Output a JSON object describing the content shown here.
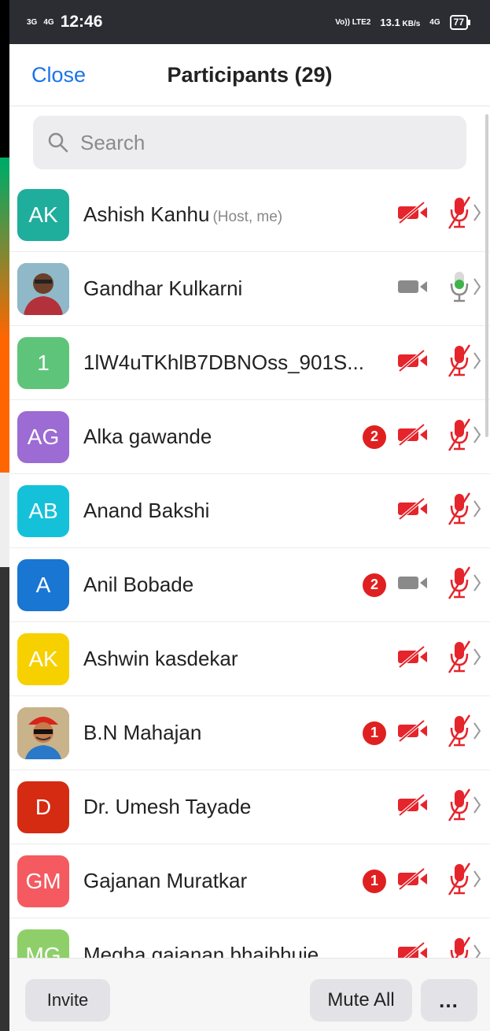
{
  "status_bar": {
    "signal1": "3G",
    "signal2": "4G",
    "time": "12:46",
    "volte": "Vo)) LTE2",
    "speed": "13.1",
    "speed_unit": "KB/s",
    "network": "4G",
    "battery": "77"
  },
  "header": {
    "close_label": "Close",
    "title": "Participants (29)"
  },
  "search": {
    "placeholder": "Search"
  },
  "participants": [
    {
      "initials": "AK",
      "name": "Ashish Kanhu",
      "sub": "(Host, me)",
      "avatar_color": "#1fae9b",
      "badge": "",
      "video": "off",
      "audio": "muted"
    },
    {
      "initials": "",
      "name": "Gandhar Kulkarni",
      "sub": "",
      "avatar_color": "#7a4a3a",
      "badge": "",
      "video": "on",
      "audio": "active",
      "photo": true
    },
    {
      "initials": "1",
      "name": "1lW4uTKhlB7DBNOss_901S...",
      "sub": "",
      "avatar_color": "#5ec47a",
      "badge": "",
      "video": "off",
      "audio": "muted"
    },
    {
      "initials": "AG",
      "name": "Alka gawande",
      "sub": "",
      "avatar_color": "#9c6bd3",
      "badge": "2",
      "video": "off",
      "audio": "muted"
    },
    {
      "initials": "AB",
      "name": "Anand Bakshi",
      "sub": "",
      "avatar_color": "#14c1d9",
      "badge": "",
      "video": "off",
      "audio": "muted"
    },
    {
      "initials": "A",
      "name": "Anil Bobade",
      "sub": "",
      "avatar_color": "#1976d2",
      "badge": "2",
      "video": "on",
      "audio": "muted"
    },
    {
      "initials": "AK",
      "name": "Ashwin kasdekar",
      "sub": "",
      "avatar_color": "#f7d000",
      "badge": "",
      "video": "off",
      "audio": "muted"
    },
    {
      "initials": "",
      "name": "B.N Mahajan",
      "sub": "",
      "avatar_color": "#b5502a",
      "badge": "1",
      "video": "off",
      "audio": "muted",
      "photo": true
    },
    {
      "initials": "D",
      "name": "Dr. Umesh Tayade",
      "sub": "",
      "avatar_color": "#d52b12",
      "badge": "",
      "video": "off",
      "audio": "muted"
    },
    {
      "initials": "GM",
      "name": "Gajanan Muratkar",
      "sub": "",
      "avatar_color": "#f45a5f",
      "badge": "1",
      "video": "off",
      "audio": "muted"
    },
    {
      "initials": "MG",
      "name": "Megha gajanan bhajbhuje",
      "sub": "",
      "avatar_color": "#8fcf6a",
      "badge": "",
      "video": "off",
      "audio": "muted"
    }
  ],
  "footer": {
    "invite_label": "Invite",
    "mute_all_label": "Mute All",
    "more_label": "…"
  },
  "colors": {
    "accent": "#1a73e8",
    "muted_red": "#e5242b",
    "badge_red": "#e02020",
    "mic_green": "#3bb54a"
  }
}
